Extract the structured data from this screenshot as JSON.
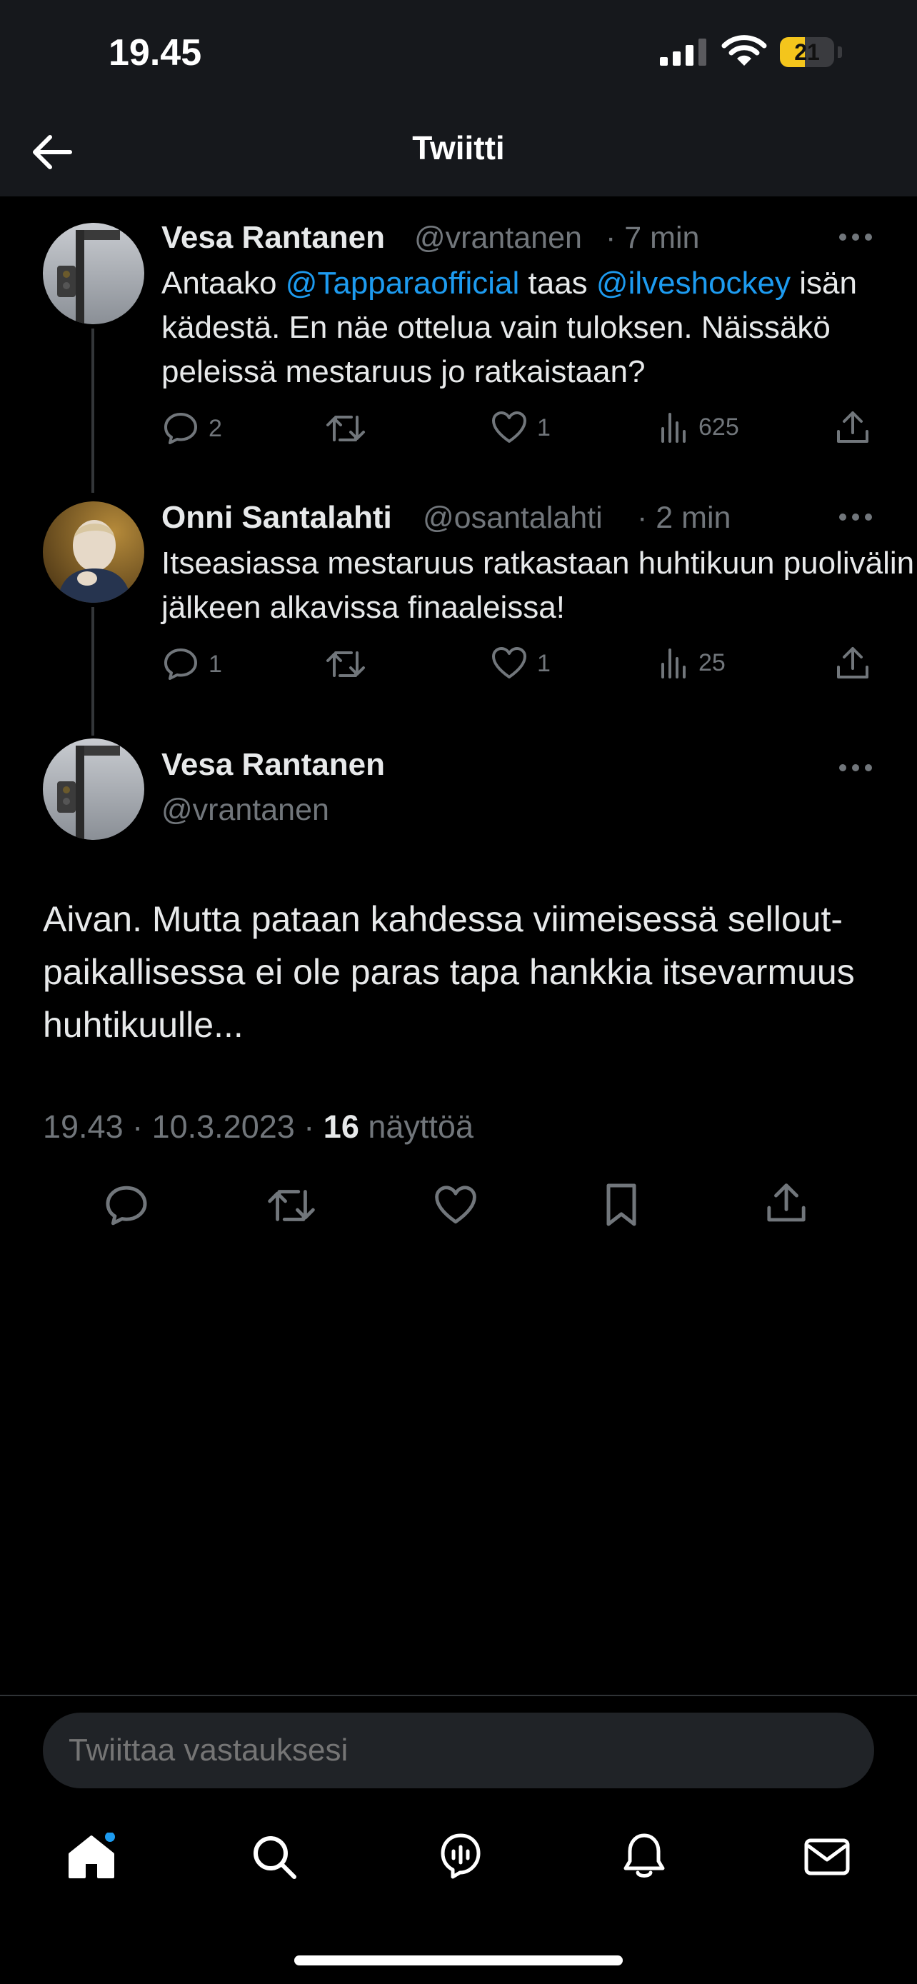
{
  "status_bar": {
    "time": "19.45",
    "battery": "21",
    "battery_level": 0.21
  },
  "header": {
    "title": "Twiitti"
  },
  "thread": [
    {
      "name": "Vesa Rantanen",
      "handle": "@vrantanen",
      "time": "· 7 min",
      "text_parts": [
        "Antaako ",
        "@Tapparaofficial",
        " taas ",
        "@ilveshockey",
        " isän kädestä. En näe ottelua vain tuloksen. Näissäkö peleissä mestaruus jo ratkaistaan?"
      ],
      "replies": "2",
      "likes": "1",
      "views": "625"
    },
    {
      "name": "Onni Santalahti",
      "handle": "@osantalahti",
      "time": "· 2 min",
      "text": "Itseasiassa mestaruus ratkastaan huhtikuun puolivälin jälkeen alkavissa finaaleissa!",
      "replies": "1",
      "likes": "1",
      "views": "25"
    }
  ],
  "main_tweet": {
    "name": "Vesa Rantanen",
    "handle": "@vrantanen",
    "text": "Aivan. Mutta pataan kahdessa viimeisessä sellout-paikallisessa ei ole paras tapa hankkia itsevarmuus huhtikuulle...",
    "timestamp": "19.43 · 10.3.2023 · ",
    "views_count": "16",
    "views_label": " näyttöä"
  },
  "reply": {
    "placeholder": "Twiittaa vastauksesi"
  },
  "tabbar": {
    "items": [
      "home-icon",
      "search-icon",
      "spaces-icon",
      "bell-icon",
      "mail-icon"
    ]
  },
  "colors": {
    "accent": "#1d9bf0",
    "background": "#000000",
    "header": "#16181c",
    "battery": "#f4c51c"
  }
}
